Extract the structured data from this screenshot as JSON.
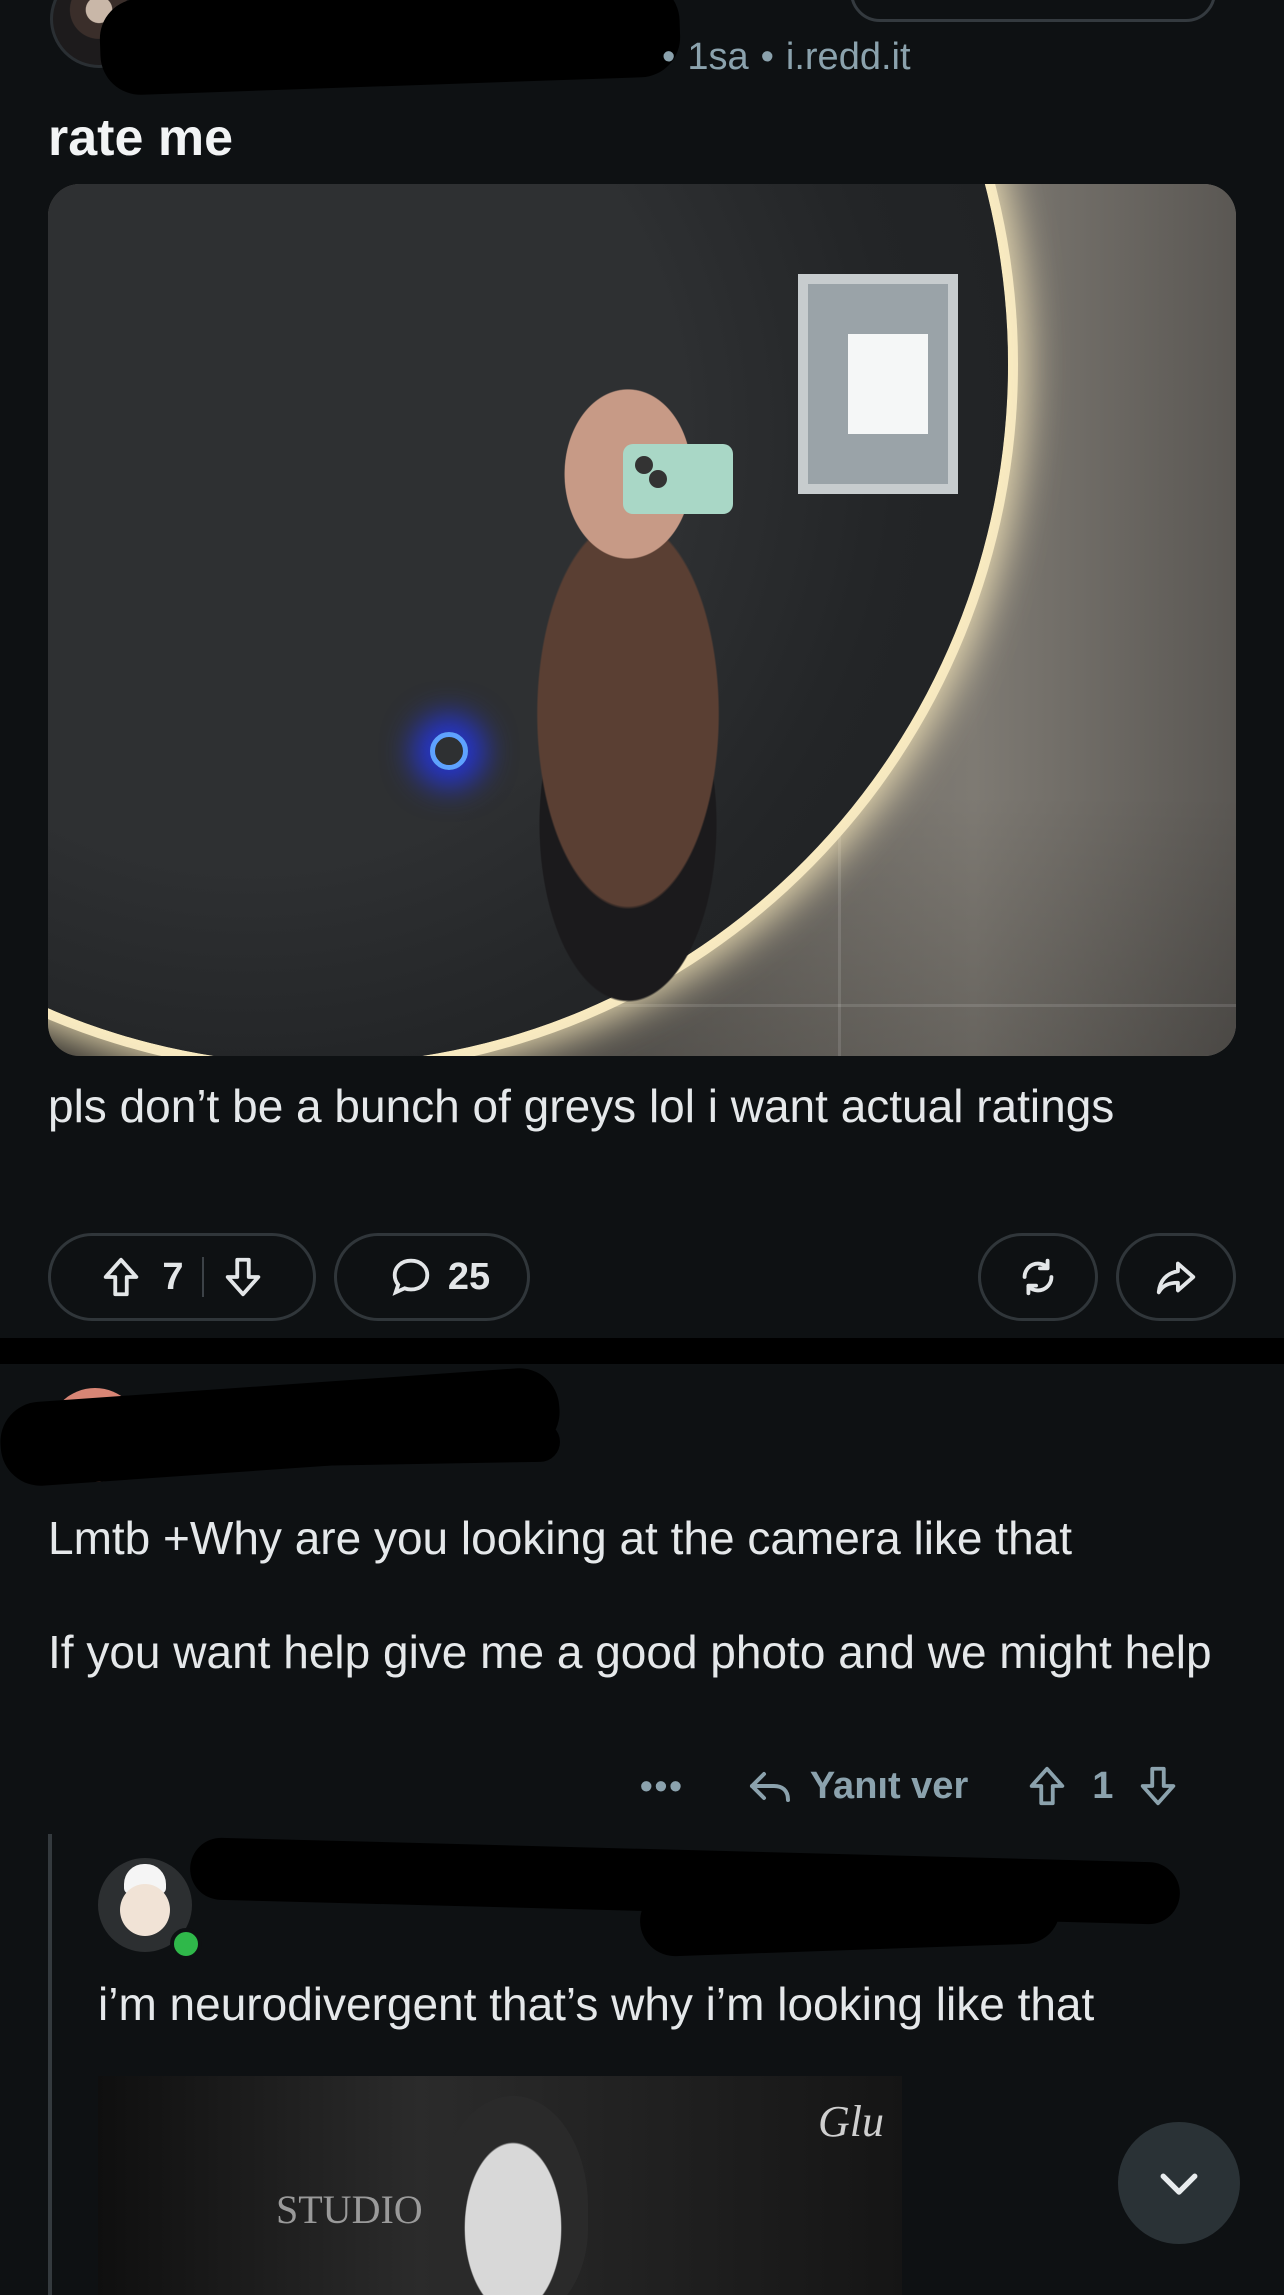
{
  "post": {
    "time": "1sa",
    "domain": "i.redd.it",
    "title": "rate me",
    "body": "pls don’t be a bunch of greys lol i want actual ratings",
    "upvotes": "7",
    "comments": "25"
  },
  "comment": {
    "line1": "Lmtb +Why are you looking at the camera  like that",
    "line2": "If you want help give me a good photo and we might help",
    "more_label": "•••",
    "reply_label": "Yanıt ver",
    "votes": "1"
  },
  "reply": {
    "text": "i’m neurodivergent that’s why i’m looking like that",
    "gif_watermark": "STUDIO",
    "gif_signature": "Glu"
  },
  "colors": {
    "background": "#0e1113",
    "meta_text": "#8ba2ad",
    "online": "#2fb84a"
  },
  "icons": {
    "upvote": "arrow-up-icon",
    "downvote": "arrow-down-icon",
    "comment": "speech-bubble-icon",
    "crosspost": "crosspost-icon",
    "share": "share-icon",
    "reply": "reply-arrow-icon",
    "scroll": "chevron-down-icon"
  }
}
